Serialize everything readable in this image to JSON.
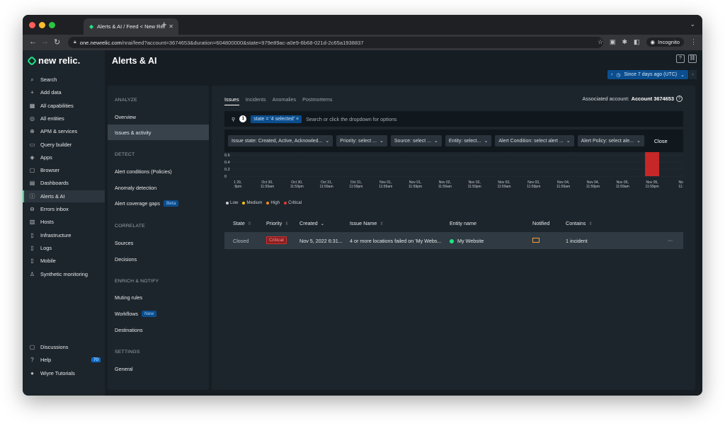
{
  "browser": {
    "tab_title": "Alerts & AI / Feed < New Relic",
    "url_host": "one.newrelic.com",
    "url_path": "/nrai/feed?account=3674653&duration=604800000&state=979e89ac-a0e9-6b68-021d-2c65a1938837",
    "incognito_label": "Incognito"
  },
  "nav": {
    "logo_text": "new relic.",
    "items": [
      {
        "label": "Search",
        "icon": "search-icon"
      },
      {
        "label": "Add data",
        "icon": "plus-icon"
      },
      {
        "label": "All capabilities",
        "icon": "grid-icon"
      },
      {
        "label": "All entities",
        "icon": "entities-icon"
      },
      {
        "label": "APM & services",
        "icon": "globe-icon"
      },
      {
        "label": "Query builder",
        "icon": "terminal-icon"
      },
      {
        "label": "Apps",
        "icon": "layers-icon"
      },
      {
        "label": "Browser",
        "icon": "browser-icon"
      },
      {
        "label": "Dashboards",
        "icon": "dashboard-icon"
      },
      {
        "label": "Alerts & AI",
        "icon": "alert-icon"
      },
      {
        "label": "Errors inbox",
        "icon": "inbox-icon"
      },
      {
        "label": "Hosts",
        "icon": "server-icon"
      },
      {
        "label": "Infrastructure",
        "icon": "infrastructure-icon"
      },
      {
        "label": "Logs",
        "icon": "logs-icon"
      },
      {
        "label": "Mobile",
        "icon": "mobile-icon"
      },
      {
        "label": "Synthetic monitoring",
        "icon": "synthetic-icon"
      }
    ],
    "bottom": [
      {
        "label": "Discussions",
        "icon": "chat-icon"
      },
      {
        "label": "Help",
        "icon": "help-icon",
        "badge": "70"
      },
      {
        "label": "Wiyre Tutorials",
        "icon": "user-avatar-icon"
      }
    ]
  },
  "header": {
    "title": "Alerts & AI",
    "time_range": "Since 7 days ago (UTC)"
  },
  "subnav": {
    "analyze": "ANALYZE",
    "overview": "Overview",
    "issues_activity": "Issues & activity",
    "detect": "DETECT",
    "alert_conditions": "Alert conditions (Policies)",
    "anomaly_detection": "Anomaly detection",
    "coverage_gaps": "Alert coverage gaps",
    "beta": "Beta",
    "correlate": "CORRELATE",
    "sources": "Sources",
    "decisions": "Decisions",
    "enrich": "ENRICH & NOTIFY",
    "muting": "Muting rules",
    "workflows": "Workflows",
    "new": "New",
    "destinations": "Destinations",
    "settings": "SETTINGS",
    "general": "General"
  },
  "content": {
    "tabs": [
      "Issues",
      "Incidents",
      "Anomalies",
      "Postmortems"
    ],
    "account_label": "Associated account:",
    "account_value": "Account 3674653",
    "filter_count": "1",
    "filter_chip": "state = '4 selected'",
    "filter_placeholder": "Search or click the dropdown for options",
    "dropdowns": [
      "Issue state: Created, Active, Acknowled...",
      "Priority: select ...",
      "Source: select ...",
      "Entity: select...",
      "Alert Condition: select alert ...",
      "Alert Policy: select ale..."
    ],
    "close": "Close"
  },
  "chart_data": {
    "type": "bar",
    "y_ticks": [
      "0.6",
      "0.4",
      "0.2",
      "0"
    ],
    "categories": [
      "1 29,\n:9pm",
      "Oct 30,\n11:59am",
      "Oct 30,\n11:59pm",
      "Oct 31,\n11:59am",
      "Oct 31,\n11:59pm",
      "Nov 01,\n11:59am",
      "Nov 01,\n11:59pm",
      "Nov 02,\n11:59am",
      "Nov 02,\n11:59pm",
      "Nov 03,\n11:59am",
      "Nov 03,\n11:59pm",
      "Nov 04,\n11:59am",
      "Nov 04,\n11:59pm",
      "Nov 05,\n11:59am",
      "Nov 05,\n11:59pm",
      "Nov\n11:5"
    ],
    "series": [
      {
        "name": "Critical",
        "color": "#c62828",
        "values": [
          0,
          0,
          0,
          0,
          0,
          0,
          0,
          0,
          0,
          0,
          0,
          0,
          0,
          0,
          1,
          0
        ]
      }
    ],
    "legend": [
      {
        "name": "Low",
        "color": "#c8cdd1"
      },
      {
        "name": "Medium",
        "color": "#f5c518"
      },
      {
        "name": "High",
        "color": "#f08a24"
      },
      {
        "name": "Critical",
        "color": "#e53935"
      }
    ]
  },
  "table": {
    "headers": {
      "state": "State",
      "priority": "Priority",
      "created": "Created",
      "issue": "Issue Name",
      "entity": "Entity name",
      "notified": "Notified",
      "contains": "Contains"
    },
    "row": {
      "state": "Closed",
      "priority": "Critical",
      "created": "Nov 5, 2022 6:31...",
      "issue": "4 or more locations failed on 'My Webs...",
      "entity": "My Website",
      "contains": "1 incident",
      "more": "···"
    }
  }
}
